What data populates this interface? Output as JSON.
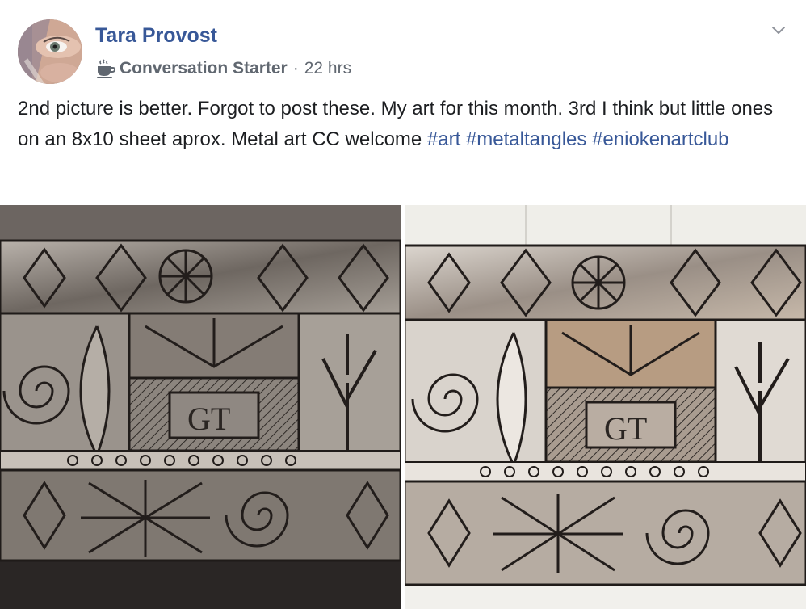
{
  "author": {
    "name": "Tara Provost",
    "avatar_icon": "profile-photo"
  },
  "meta": {
    "badge_icon": "coffee-cup-icon",
    "badge_label": "Conversation Starter",
    "separator": "·",
    "timestamp": "22 hrs"
  },
  "menu": {
    "icon": "chevron-down-icon"
  },
  "post": {
    "text": "2nd picture is better. Forgot to post these. My art for this month. 3rd I think but little ones on an 8x10 sheet aprox. Metal art CC welcome ",
    "hashtags": [
      "#art",
      "#metaltangles",
      "#eniokenartclub"
    ]
  },
  "photos": [
    {
      "name": "metal-art-photo-1",
      "tone": "dark"
    },
    {
      "name": "metal-art-photo-2",
      "tone": "bright"
    }
  ],
  "colors": {
    "link": "#385898",
    "text": "#1c1e21",
    "meta": "#606770"
  }
}
